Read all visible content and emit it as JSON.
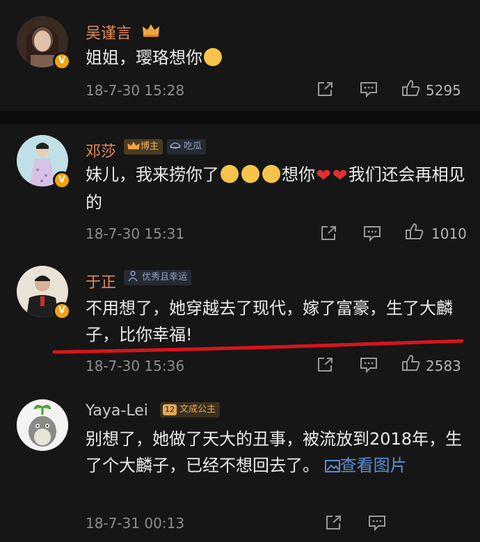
{
  "comments": [
    {
      "name": "吴谨言",
      "text_a": "姐姐，璎珞想你",
      "time": "18-7-30 15:28",
      "likes": "5295",
      "badge_color": "#f4a20a"
    },
    {
      "name": "邓莎",
      "tag1": "博主",
      "tag2": "吃瓜",
      "text_a": "妹儿，我来捞你了",
      "text_b": "想你",
      "text_c": "我们还会再相见的",
      "time": "18-7-30 15:31",
      "likes": "1010"
    },
    {
      "name": "于正",
      "tag1": "优秀且幸运",
      "text_a": "不用想了，她穿越去了现代，嫁了富豪，生了大麟子，比你幸福!",
      "time": "18-7-30 15:36",
      "likes": "2583"
    },
    {
      "name": "Yaya-Lei",
      "tag1": "文成公主",
      "tag1_level": "12",
      "text_a": "别想了，她做了天大的丑事，被流放到2018年，生了个大麟子，已经不想回去了。",
      "link_text": "查看图片",
      "time": "18-7-31 00:13"
    }
  ],
  "colors": {
    "background": "#161616",
    "name_highlight": "#e58a5a",
    "vip_badge": "#f4a20a",
    "link": "#5a8fd6",
    "underline": "#d8141c"
  },
  "icons": [
    "share-icon",
    "comment-icon",
    "like-icon",
    "crown-icon",
    "v-verified-icon",
    "image-icon"
  ]
}
